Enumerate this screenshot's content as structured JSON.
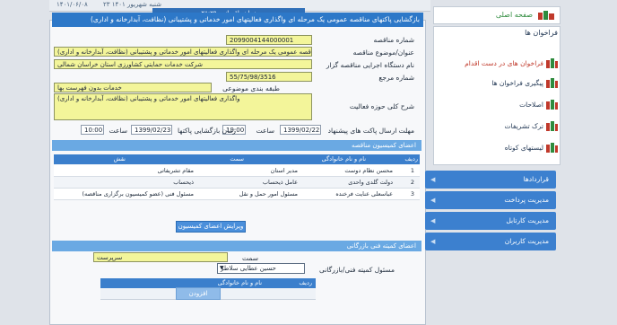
{
  "top": {
    "date_text": "۱۴۰۱/۰۶/۰۸",
    "day_text": "۲۳ شنبه شهریور ۱۴۰۱",
    "caption": "زمان باقیمانده ۲۸:۲۹"
  },
  "header": {
    "title": "بازگشایی پاکتهای مناقصه عمومی یک مرحله ای واگذاری فعالیتهای امور خدماتی و پشتیبانی (نظافت، آبدارخانه و اداری)"
  },
  "form": {
    "tender_number_label": "شماره مناقصه",
    "tender_number": "2099004144000001",
    "subject_label": "عنوان/موضوع مناقصه",
    "subject": "مناقصه عمومی یک مرحله ای واگذاری فعالیتهای امور خدماتی و پشتیبانی (نظافت، آبدارخانه و اداری)",
    "executor_label": "نام دستگاه اجرایی مناقصه گزار",
    "executor": "شرکت خدمات حمایتی کشاورزی استان خراسان شمالی",
    "reference_label": "شماره مرجع",
    "reference": "55/75/98/3516",
    "classification_label": "طبقه بندی موضوعی",
    "classification": "خدمات بدون فهرست بها",
    "activity_label": "شرح کلی حوزه فعالیت",
    "activity": "واگذاری فعالیتهای امور خدماتی و پشتیبانی (نظافت، آبدارخانه و اداری)",
    "deadline_label": "مهلت ارسال پاکت های پیشنهاد",
    "deadline_date": "1399/02/22",
    "time_label": "ساعت",
    "deadline_time": "19:00",
    "opening_label": "زمان بازگشایی پاکتها",
    "opening_date": "1399/02/23",
    "opening_time": "10:00"
  },
  "committee": {
    "section_title": "اعضای کمیسیون مناقصه",
    "columns": [
      "ردیف",
      "نام و نام خانوادگی",
      "سمت",
      "سمت",
      "نقش"
    ],
    "rows": [
      {
        "n": "1",
        "name": "محسن نظام دوست",
        "post": "مدیر استان",
        "role": "مقام تشریفاتی"
      },
      {
        "n": "2",
        "name": "دولت گلدی واحدی",
        "post": "عامل ذیحساب",
        "role": "ذیحساب"
      },
      {
        "n": "3",
        "name": "عباسعلی عنایت فرخنده",
        "post": "مسئول امور حمل و نقل",
        "role": "مسئول فنی (عضو کمیسیون برگزاری مناقصه)"
      }
    ],
    "edit_button": "ویرایش اعضای کمیسیون"
  },
  "technical": {
    "section_title": "اعضای کمیته فنی بازرگانی",
    "position_label": "سمت",
    "position": "سرپرست",
    "person_label": "مسئول کمیته فنی/بازرگانی",
    "person": "حسین عطایی سلاطر",
    "col_row": "ردیف",
    "col_name": "نام و نام خانوادگی",
    "add_button": "افزودن"
  },
  "sidebar": {
    "home": "صفحه اصلی",
    "calls_title": "فراخوان ها",
    "items": [
      {
        "label": "فراخوان های در دست اقدام",
        "icon": "document-icon"
      },
      {
        "label": "پیگیری فراخوان ها",
        "icon": "document-icon"
      },
      {
        "label": "اصلاحات",
        "icon": "document-icon"
      },
      {
        "label": "ترک تشریفات",
        "icon": "document-icon"
      },
      {
        "label": "لیستهای کوتاه",
        "icon": "document-icon"
      }
    ],
    "menus": [
      "قراردادها",
      "مدیریت پرداخت",
      "مدیریت کارتابل",
      "مدیریت کاربران"
    ]
  },
  "colors": {
    "header_blue": "#2d78c8",
    "field_yellow": "#f3f59a",
    "section_blue": "#6aa9e3",
    "icon_red": "#c0392b",
    "icon_green": "#2e8b3d"
  }
}
